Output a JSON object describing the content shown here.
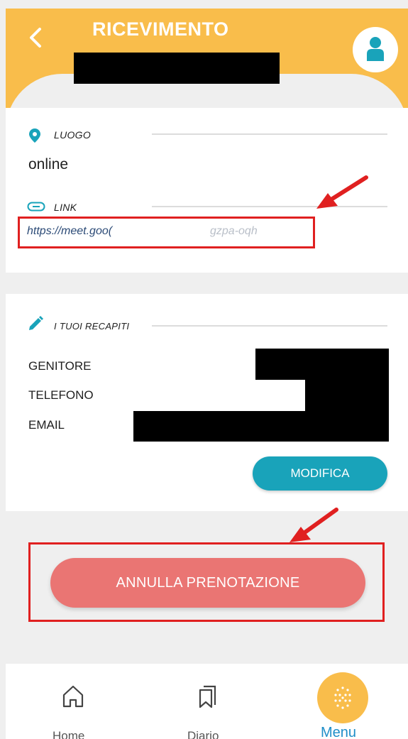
{
  "header": {
    "title": "RICEVIMENTO"
  },
  "place_section": {
    "luogo_label": "LUOGO",
    "luogo_value": "online",
    "link_label": "LINK",
    "link_value_visible": "https://meet.goo(",
    "link_value_tail": "gzpa-oqh"
  },
  "contacts_section": {
    "label": "I TUOI RECAPITI",
    "rows": [
      {
        "label": "GENITORE"
      },
      {
        "label": "TELEFONO"
      },
      {
        "label": "EMAIL"
      }
    ],
    "modify_label": "MODIFICA"
  },
  "cancel": {
    "label": "ANNULLA PRENOTAZIONE"
  },
  "bottom_nav": {
    "items": [
      {
        "label": "Home",
        "icon": "home-icon"
      },
      {
        "label": "Diario",
        "icon": "bookmarks-icon"
      },
      {
        "label": "Menu",
        "icon": "grid-dots-icon"
      }
    ]
  },
  "colors": {
    "header": "#f9bd4b",
    "teal": "#19a3ba",
    "cancel": "#ea7573",
    "highlight_red": "#e02020",
    "menu_active": "#1e8ec8"
  }
}
